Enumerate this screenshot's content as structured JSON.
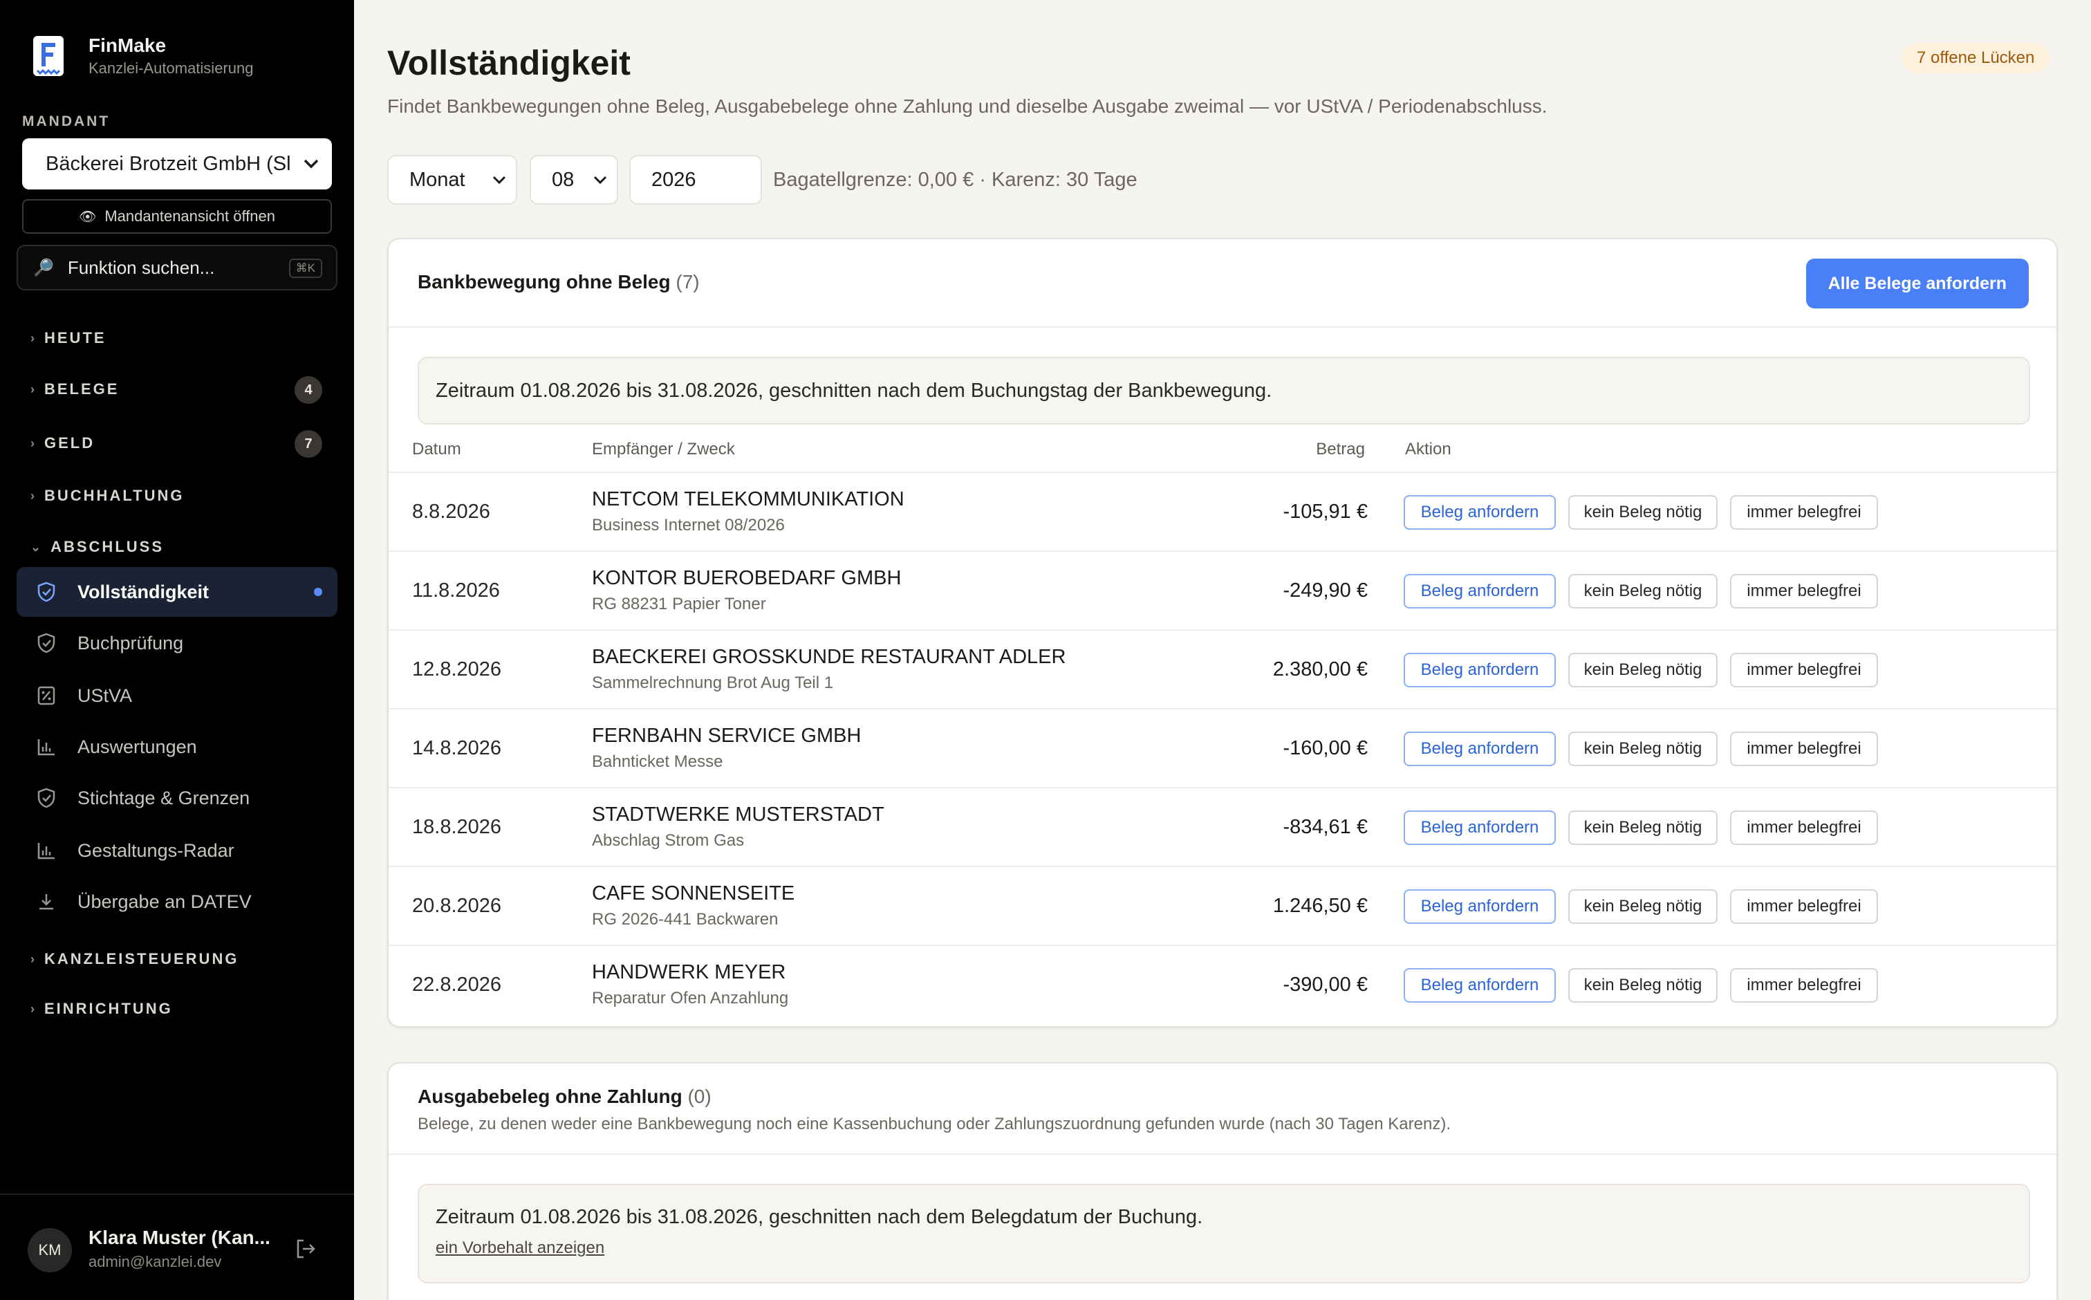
{
  "brand": {
    "name": "FinMake",
    "subtitle": "Kanzlei-Automatisierung"
  },
  "mandant": {
    "label": "MANDANT",
    "selected": "Bäckerei Brotzeit GmbH (Sl",
    "open_view_label": "Mandantenansicht öffnen"
  },
  "search": {
    "placeholder": "Funktion suchen...",
    "shortcut": "⌘K"
  },
  "nav": {
    "groups": [
      {
        "label": "HEUTE",
        "badge": ""
      },
      {
        "label": "BELEGE",
        "badge": "4"
      },
      {
        "label": "GELD",
        "badge": "7"
      },
      {
        "label": "BUCHHALTUNG",
        "badge": ""
      },
      {
        "label": "ABSCHLUSS",
        "badge": ""
      },
      {
        "label": "KANZLEISTEUERUNG",
        "badge": ""
      },
      {
        "label": "EINRICHTUNG",
        "badge": ""
      }
    ],
    "items": [
      {
        "label": "Vollständigkeit",
        "icon": "shield-check-icon",
        "active": true
      },
      {
        "label": "Buchprüfung",
        "icon": "shield-check-icon"
      },
      {
        "label": "UStVA",
        "icon": "percent-icon"
      },
      {
        "label": "Auswertungen",
        "icon": "bar-chart-icon"
      },
      {
        "label": "Stichtage & Grenzen",
        "icon": "shield-check-icon"
      },
      {
        "label": "Gestaltungs-Radar",
        "icon": "bar-chart-icon"
      },
      {
        "label": "Übergabe an DATEV",
        "icon": "download-icon"
      }
    ]
  },
  "user": {
    "initials": "KM",
    "name": "Klara Muster (Kan...",
    "email": "admin@kanzlei.dev"
  },
  "page": {
    "title": "Vollständigkeit",
    "subtitle": "Findet Bankbewegungen ohne Beleg, Ausgabebelege ohne Zahlung und dieselbe Ausgabe zweimal — vor UStVA / Periodenabschluss.",
    "open_gaps": "7 offene Lücken"
  },
  "filters": {
    "period_type": "Monat",
    "month": "08",
    "year": "2026",
    "info": "Bagatellgrenze: 0,00 € · Karenz: 30 Tage"
  },
  "bank_section": {
    "title": "Bankbewegung ohne Beleg",
    "count": "(7)",
    "primary_action": "Alle Belege anfordern",
    "note": "Zeitraum 01.08.2026 bis 31.08.2026, geschnitten nach dem Buchungstag der Bankbewegung.",
    "columns": {
      "date": "Datum",
      "payee": "Empfänger / Zweck",
      "amount": "Betrag",
      "action": "Aktion"
    },
    "actions": {
      "request": "Beleg anfordern",
      "not_needed": "kein Beleg nötig",
      "always_free": "immer belegfrei"
    },
    "rows": [
      {
        "date": "8.8.2026",
        "name": "NETCOM TELEKOMMUNIKATION",
        "purpose": "Business Internet 08/2026",
        "amount": "-105,91 €"
      },
      {
        "date": "11.8.2026",
        "name": "KONTOR BUEROBEDARF GMBH",
        "purpose": "RG 88231 Papier Toner",
        "amount": "-249,90 €"
      },
      {
        "date": "12.8.2026",
        "name": "BAECKEREI GROSSKUNDE RESTAURANT ADLER",
        "purpose": "Sammelrechnung Brot Aug Teil 1",
        "amount": "2.380,00 €"
      },
      {
        "date": "14.8.2026",
        "name": "FERNBAHN SERVICE GMBH",
        "purpose": "Bahnticket Messe",
        "amount": "-160,00 €"
      },
      {
        "date": "18.8.2026",
        "name": "STADTWERKE MUSTERSTADT",
        "purpose": "Abschlag Strom Gas",
        "amount": "-834,61 €"
      },
      {
        "date": "20.8.2026",
        "name": "CAFE SONNENSEITE",
        "purpose": "RG 2026-441 Backwaren",
        "amount": "1.246,50 €"
      },
      {
        "date": "22.8.2026",
        "name": "HANDWERK MEYER",
        "purpose": "Reparatur Ofen Anzahlung",
        "amount": "-390,00 €"
      }
    ]
  },
  "expense_section": {
    "title": "Ausgabebeleg ohne Zahlung",
    "count": "(0)",
    "description": "Belege, zu denen weder eine Bankbewegung noch eine Kassenbuchung oder Zahlungszuordnung gefunden wurde (nach 30 Tagen Karenz).",
    "note": "Zeitraum 01.08.2026 bis 31.08.2026, geschnitten nach dem Belegdatum der Buchung.",
    "note_link": "ein Vorbehalt anzeigen"
  }
}
